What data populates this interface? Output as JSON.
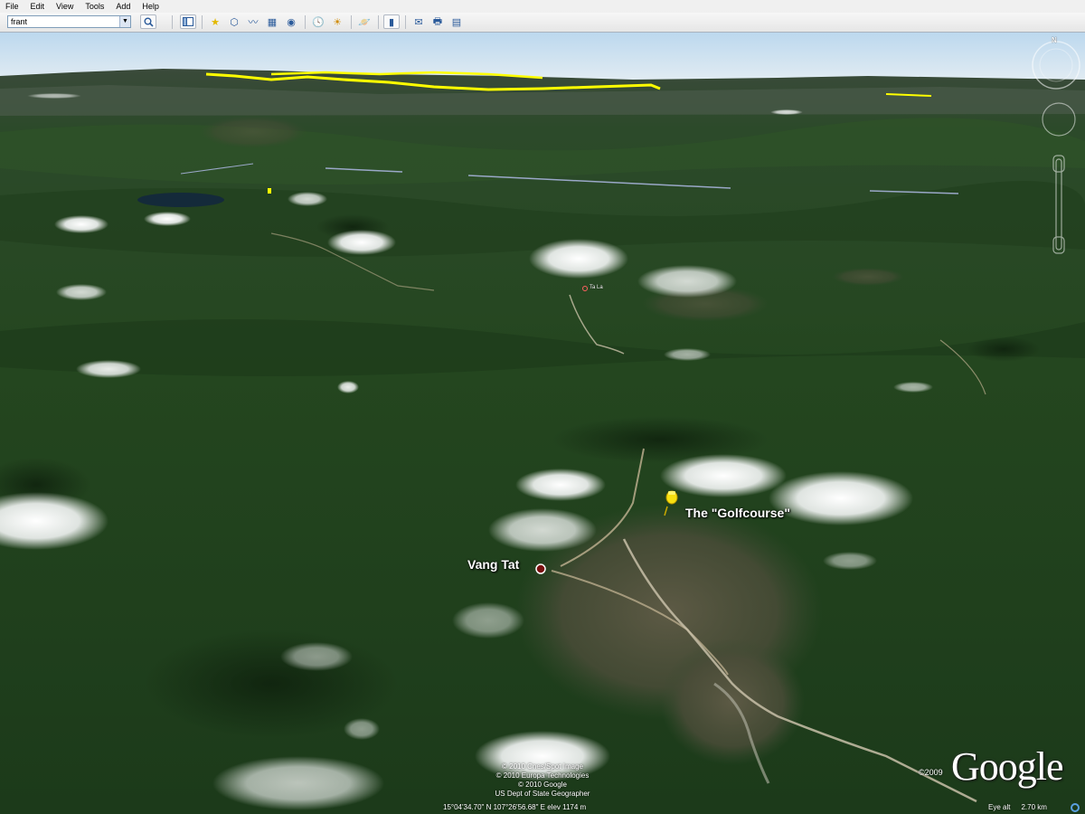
{
  "menu": [
    "File",
    "Edit",
    "View",
    "Tools",
    "Add",
    "Help"
  ],
  "search": {
    "value": "frant"
  },
  "toolbar": {
    "icons": [
      "search-icon",
      "sidebar-icon",
      "placemark-icon",
      "polygon-icon",
      "path-icon",
      "overlay-icon",
      "tour-icon",
      "clock-icon",
      "sunlight-icon",
      "planets-icon",
      "ruler-icon",
      "email-icon",
      "print-icon",
      "map-view-icon"
    ]
  },
  "places": [
    {
      "name": "Vang Tat"
    },
    {
      "name": "The \"Golfcourse\""
    },
    {
      "name": "Ta La"
    }
  ],
  "compass": {
    "north": "N"
  },
  "credits": [
    "© 2010 Cnes/Spot Image",
    "© 2010 Europa Technologies",
    "© 2010 Google",
    "US Dept of State Geographer"
  ],
  "status": {
    "coords": "15°04'34.70\" N    107°26'56.68\" E    elev  1174 m",
    "eye_alt_label": "Eye alt",
    "eye_alt_value": "2.70 km"
  },
  "logo": {
    "text": "Google",
    "year": "©2009"
  },
  "colors": {
    "forest": "#1f3d1e",
    "sky": "#cfe4f3",
    "highlight": "#ffff00",
    "pin": "#f7e010"
  }
}
